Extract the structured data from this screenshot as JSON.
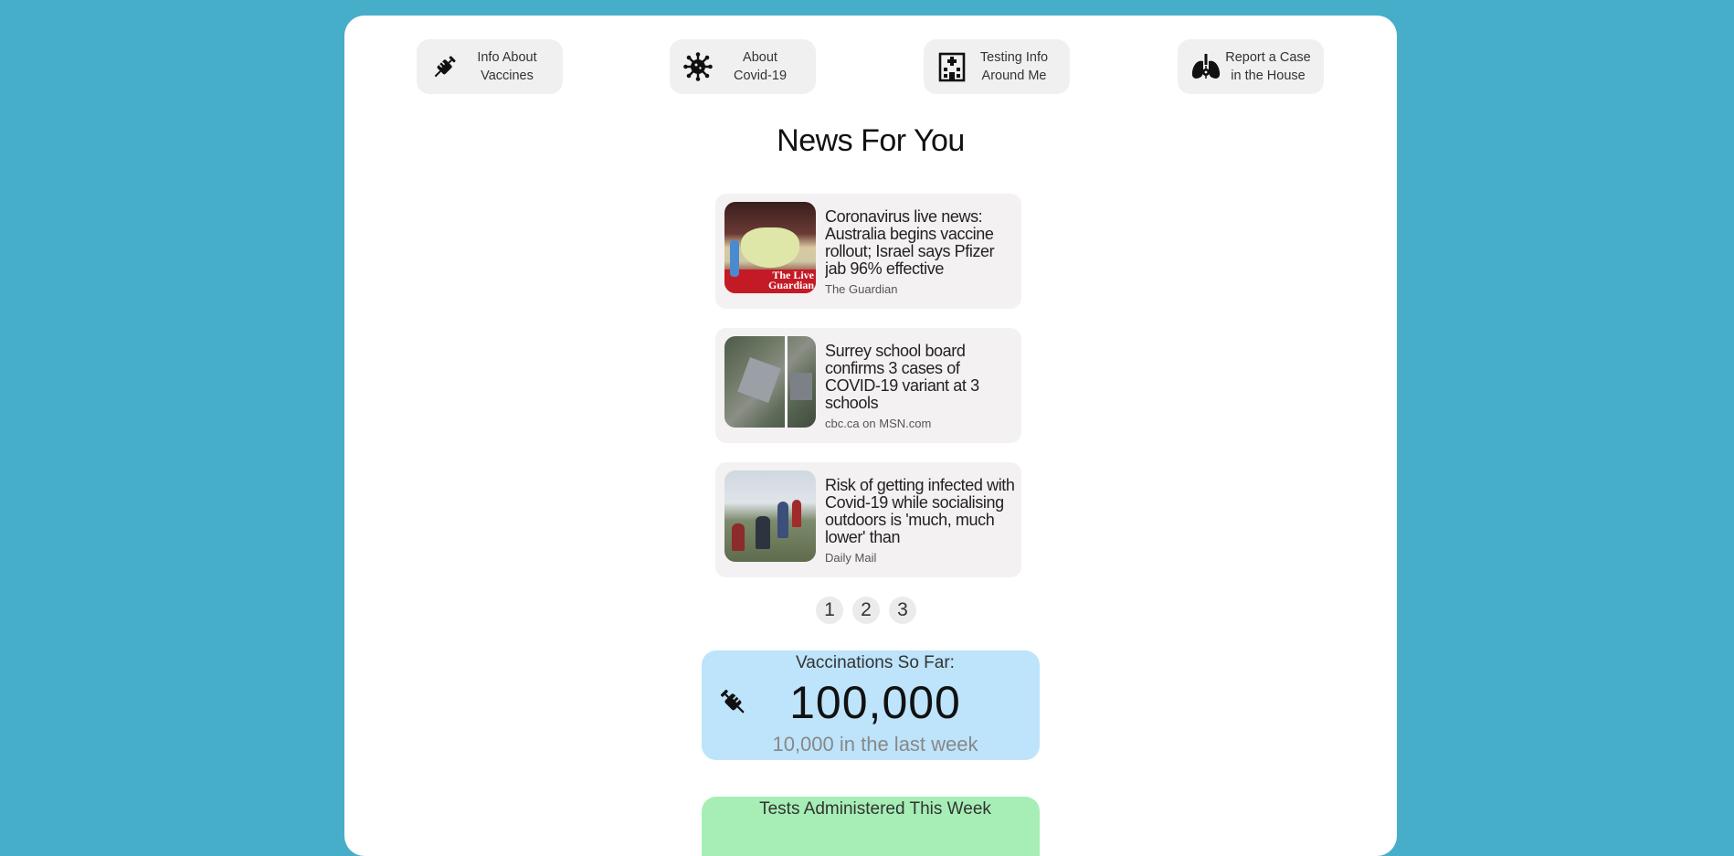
{
  "nav": [
    {
      "label": "Info About\nVaccines",
      "icon": "syringe-icon"
    },
    {
      "label": "About\nCovid-19",
      "icon": "virus-icon"
    },
    {
      "label": "Testing Info\nAround Me",
      "icon": "hospital-icon"
    },
    {
      "label": "Report a Case\nin the House",
      "icon": "lungs-virus-icon"
    }
  ],
  "news": {
    "title": "News For You",
    "items": [
      {
        "headline": "Coronavirus live news: Australia begins vaccine rollout; Israel says Pfizer jab 96% effective",
        "source": "The Guardian",
        "thumb_text": "The Live Guardian"
      },
      {
        "headline": "Surrey school board confirms 3 cases of COVID-19 variant at 3 schools",
        "source": "cbc.ca on MSN.com"
      },
      {
        "headline": "Risk of getting infected with Covid-19 while socialising outdoors is 'much, much lower' than",
        "source": "Daily Mail"
      }
    ],
    "pages": [
      "1",
      "2",
      "3"
    ]
  },
  "stats": {
    "vaccinations": {
      "label": "Vaccinations So Far:",
      "value": "100,000",
      "sub": "10,000 in the last week",
      "icon": "syringe-icon"
    },
    "tests": {
      "label": "Tests Administered This Week"
    }
  },
  "colors": {
    "background": "#46aec8",
    "vaccination_card": "#bde4fb",
    "tests_card": "#a7eeb6"
  }
}
